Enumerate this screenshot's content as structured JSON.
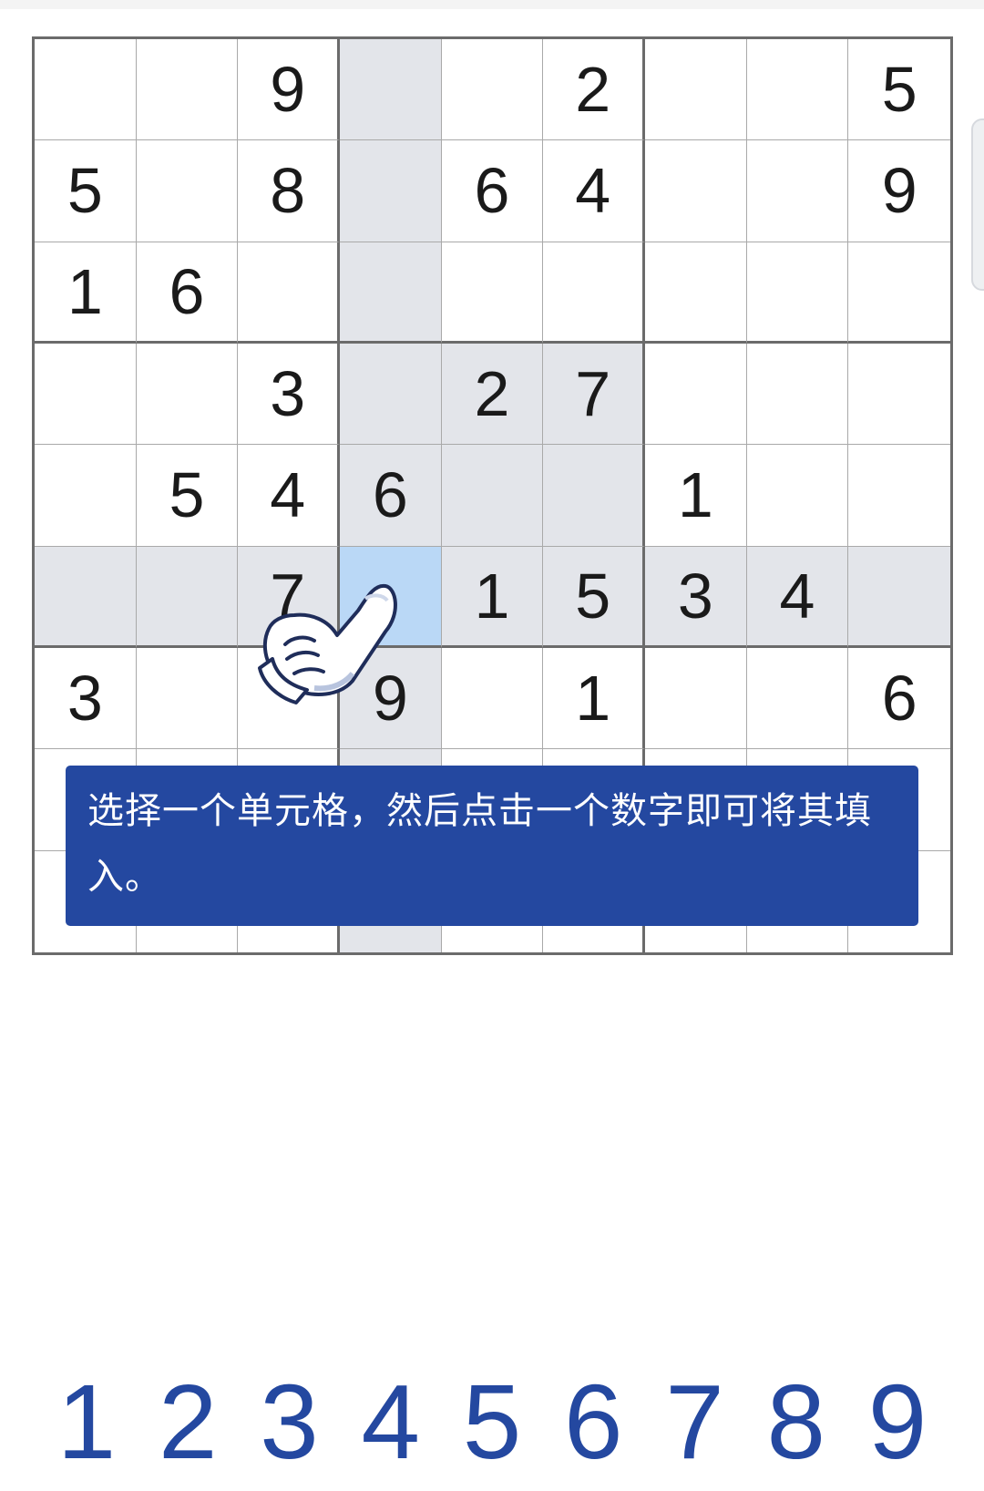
{
  "board": {
    "rows": [
      [
        "",
        "",
        "9",
        "",
        "",
        "2",
        "",
        "",
        "5"
      ],
      [
        "5",
        "",
        "8",
        "",
        "6",
        "4",
        "",
        "",
        "9"
      ],
      [
        "1",
        "6",
        "",
        "",
        "",
        "",
        "",
        "",
        ""
      ],
      [
        "",
        "",
        "3",
        "",
        "2",
        "7",
        "",
        "",
        ""
      ],
      [
        "",
        "5",
        "4",
        "6",
        "",
        "",
        "1",
        "",
        ""
      ],
      [
        "",
        "",
        "7",
        "",
        "1",
        "5",
        "3",
        "4",
        ""
      ],
      [
        "3",
        "",
        "",
        "9",
        "",
        "1",
        "",
        "",
        "6"
      ],
      [
        "",
        "",
        "",
        "",
        "",
        "",
        "",
        "",
        ""
      ],
      [
        "",
        "",
        "",
        "",
        "",
        "",
        "",
        "",
        ""
      ]
    ],
    "selected_cell": {
      "row": 6,
      "col": 4
    },
    "highlight_color": "#e3e5ea",
    "selected_color": "#bad8f6"
  },
  "tooltip": {
    "text": "选择一个单元格，然后点击一个数字即可将其填入。",
    "background": "#2448a0"
  },
  "numpad": {
    "digits": [
      "1",
      "2",
      "3",
      "4",
      "5",
      "6",
      "7",
      "8",
      "9"
    ],
    "color": "#2448a0"
  }
}
